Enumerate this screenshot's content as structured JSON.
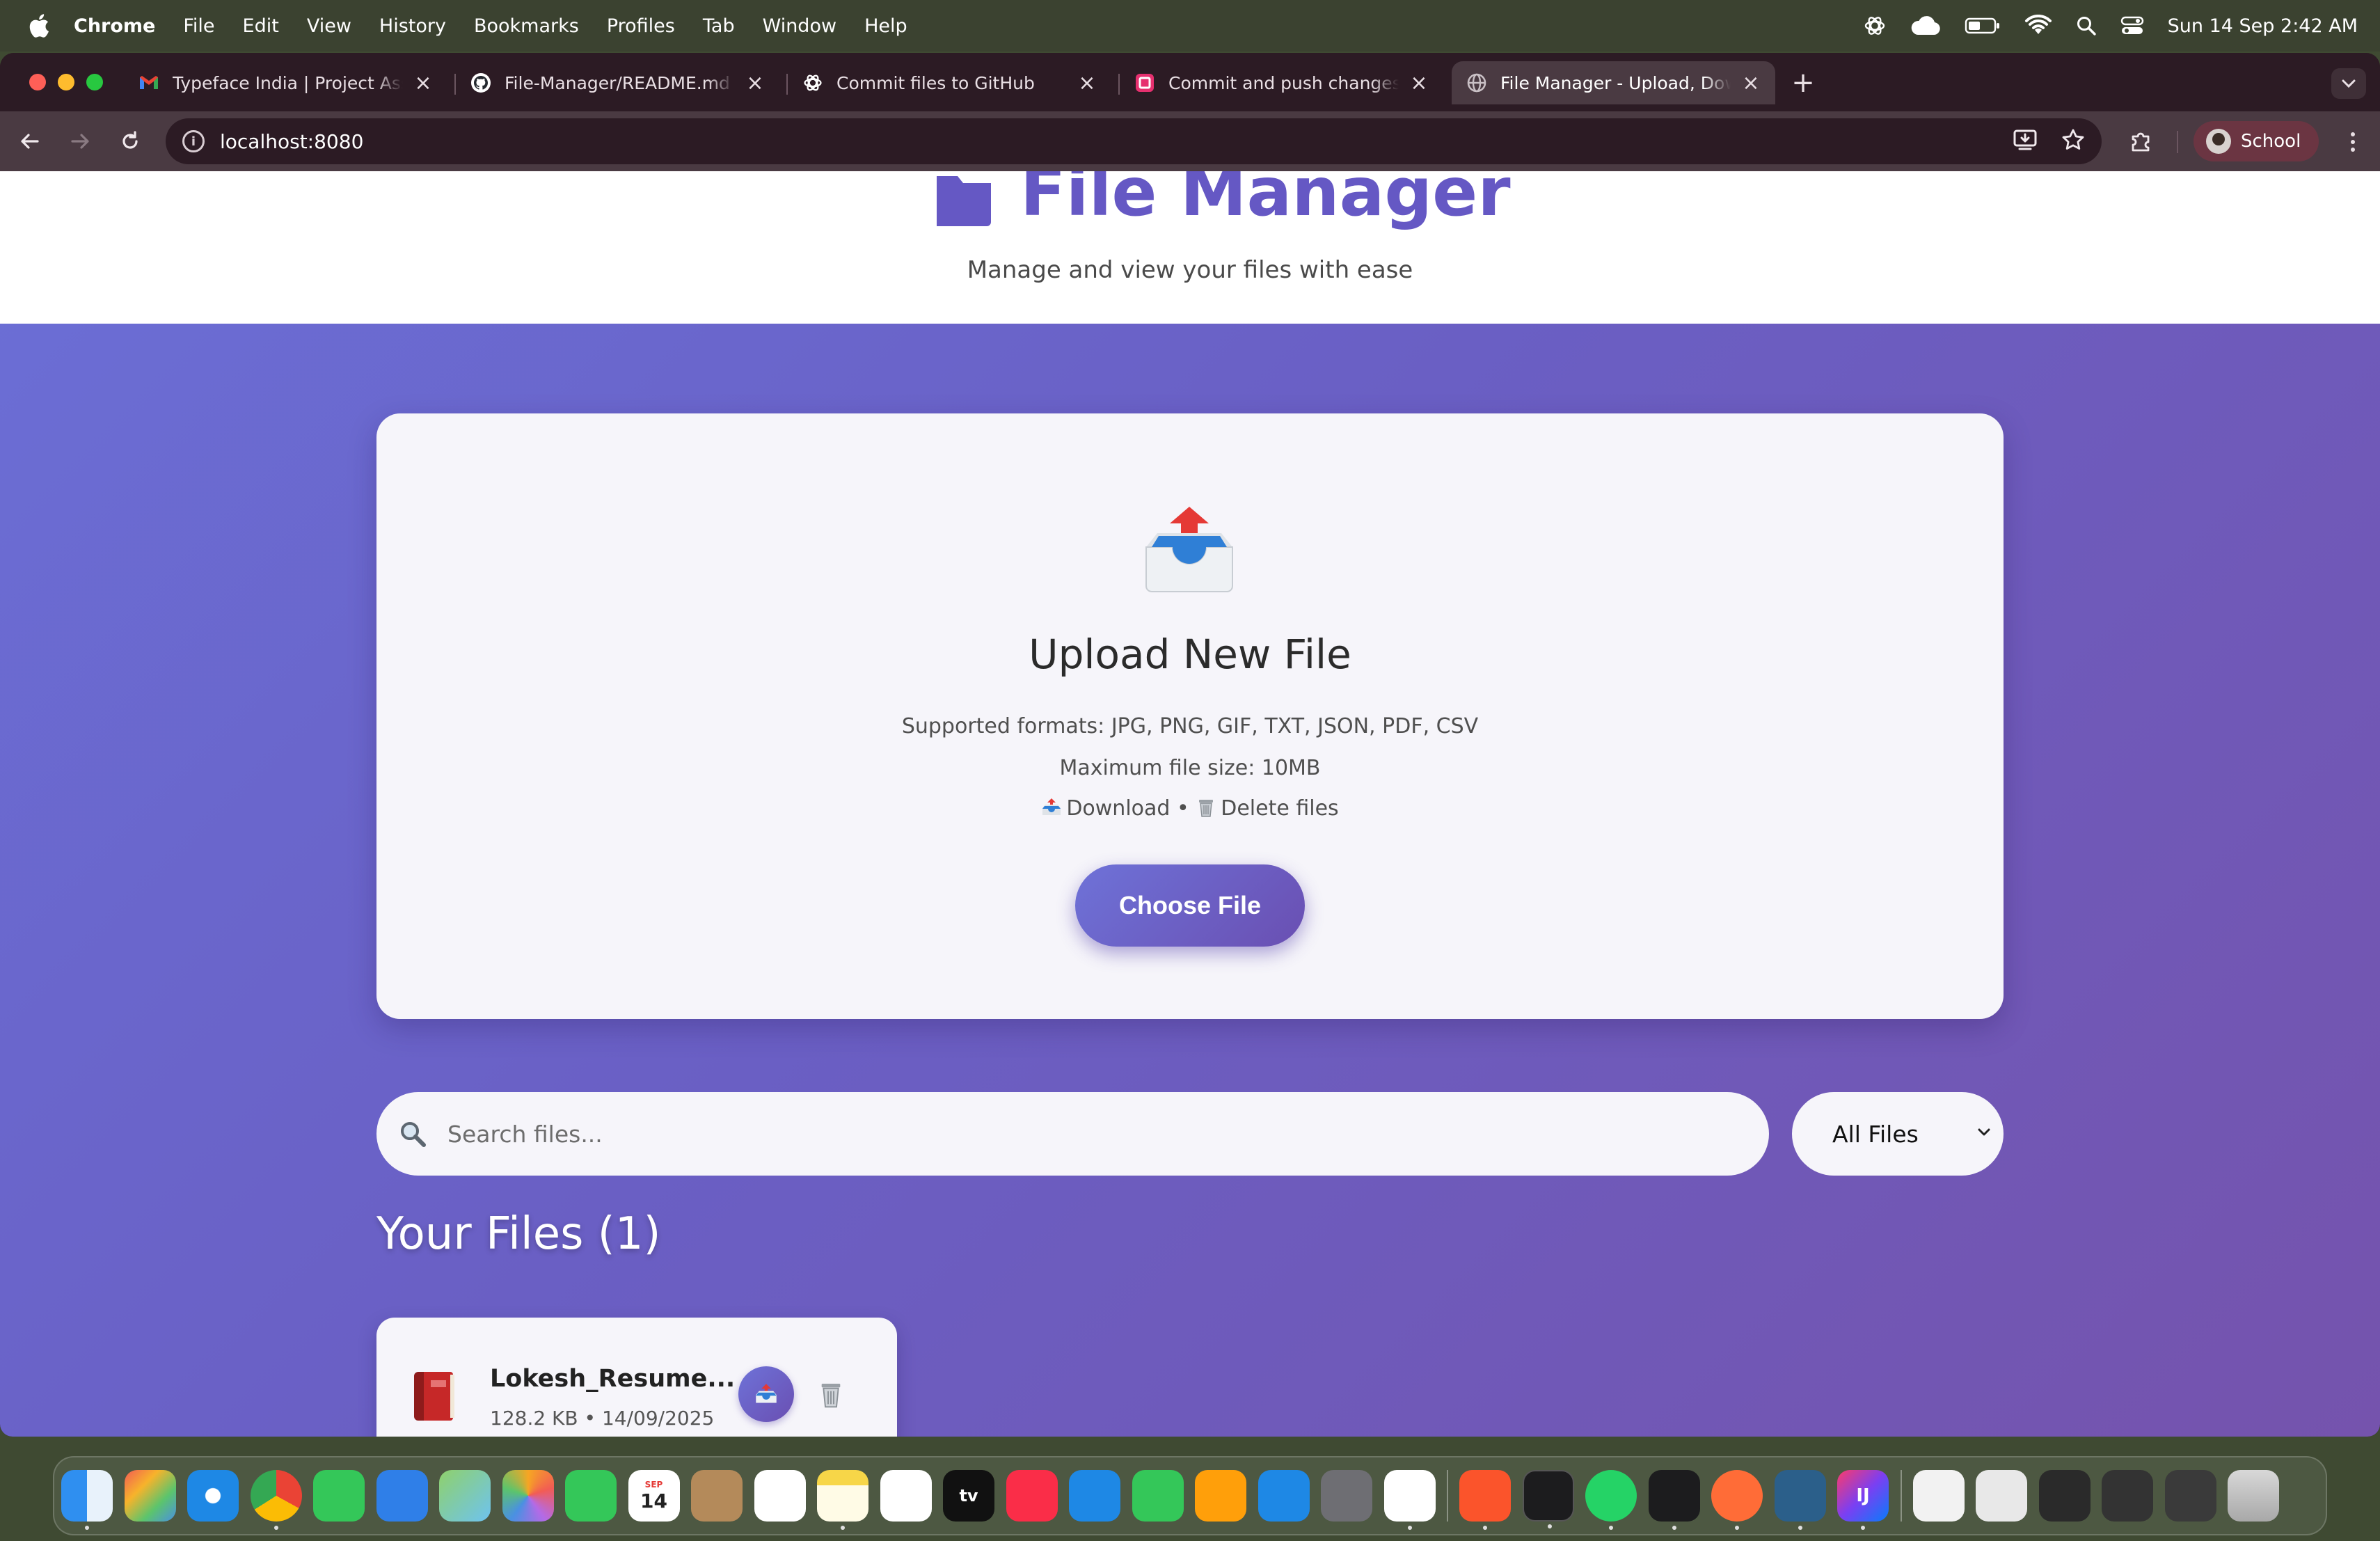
{
  "menubar": {
    "apple_icon": "apple-logo-icon",
    "items": [
      "Chrome",
      "File",
      "Edit",
      "View",
      "History",
      "Bookmarks",
      "Profiles",
      "Tab",
      "Window",
      "Help"
    ],
    "status_icons": [
      "chatgpt-icon",
      "icloud-icon",
      "battery-icon",
      "wifi-icon",
      "spotlight-search-icon",
      "control-center-icon"
    ],
    "clock": "Sun 14 Sep  2:42 AM"
  },
  "browser": {
    "tabs": [
      {
        "title": "Typeface India | Project Assignment",
        "icon": "gmail-icon"
      },
      {
        "title": "File-Manager/README.md at main",
        "icon": "github-icon"
      },
      {
        "title": "Commit files to GitHub",
        "icon": "chatgpt-icon"
      },
      {
        "title": "Commit and push changes to GitHub",
        "icon": "app-icon"
      },
      {
        "title": "File Manager - Upload, Download",
        "icon": "globe-icon"
      }
    ],
    "active_tab": 4,
    "url": "localhost:8080",
    "profile_label": "School"
  },
  "page": {
    "title": "File Manager",
    "subtitle": "Manage and view your files with ease",
    "upload": {
      "title": "Upload New File",
      "formats": "Supported formats: JPG, PNG, GIF, TXT, JSON, PDF, CSV",
      "max_size": "Maximum file size: 10MB",
      "download_label": "Download",
      "separator": "•",
      "delete_label": "Delete files",
      "button": "Choose File"
    },
    "search": {
      "placeholder": "Search files..."
    },
    "filter": {
      "selected": "All Files"
    },
    "files_heading": "Your Files (1)",
    "files": [
      {
        "name": "Lokesh_Resume...",
        "size": "128.2 KB",
        "date": "14/09/2025",
        "meta": "128.2 KB • 14/09/2025"
      }
    ]
  },
  "colors": {
    "accent": "#6558c4",
    "gradient_start": "#6b6fd6",
    "gradient_end": "#7553ad",
    "card_bg": "#f6f5fa"
  },
  "dock": {
    "apps": [
      "finder",
      "launchpad",
      "safari",
      "chrome",
      "messages",
      "mail",
      "maps",
      "photos",
      "facetime",
      "calendar",
      "contacts",
      "reminders",
      "notes",
      "freeform",
      "apple-tv",
      "music",
      "keynote",
      "numbers",
      "pages",
      "app-store",
      "system-settings",
      "chatgpt",
      "brave",
      "terminal",
      "whatsapp",
      "app",
      "postman",
      "mysql-workbench",
      "intellij-idea",
      "document",
      "downloads",
      "trash"
    ],
    "calendar_month": "SEP",
    "calendar_day": "14",
    "tv_label": "tv",
    "ij_label": "IJ"
  }
}
